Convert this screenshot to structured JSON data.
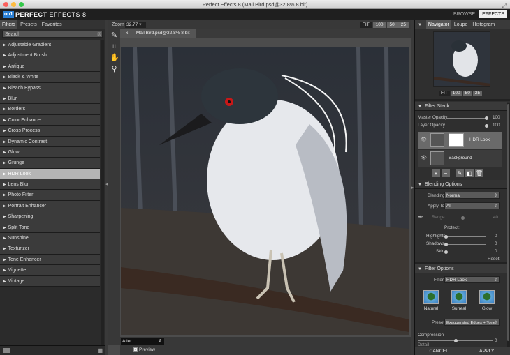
{
  "window": {
    "title": "Perfect Effects 8 (Mail Bird.psd@32.8% 8 bit)"
  },
  "brand": {
    "logo": "on1",
    "name_bold": "PERFECT",
    "name_rest": " EFFECTS 8"
  },
  "modes": {
    "browse": "BROWSE",
    "effects": "EFFECTS"
  },
  "left_panel": {
    "tabs": [
      "Filters",
      "Presets",
      "Favorites"
    ],
    "search_placeholder": "Search",
    "filters": [
      "Adjustable Gradient",
      "Adjustment Brush",
      "Antique",
      "Black & White",
      "Bleach Bypass",
      "Blur",
      "Borders",
      "Color Enhancer",
      "Cross Process",
      "Dynamic Contrast",
      "Glow",
      "Grunge",
      "HDR Look",
      "Lens Blur",
      "Photo Filter",
      "Portrait Enhancer",
      "Sharpening",
      "Split Tone",
      "Sunshine",
      "Texturizer",
      "Tone Enhancer",
      "Vignette",
      "Vintage"
    ],
    "selected_filter": "HDR Look"
  },
  "canvas": {
    "zoom_label": "Zoom",
    "zoom_value": "32.77",
    "zoom_buttons": [
      "FIT",
      "100",
      "50",
      "25"
    ],
    "doc_tab": "Mail Bird.psd@32.8% 8 bit",
    "view_mode": "After",
    "preview_label": "Preview"
  },
  "navigator": {
    "tabs": [
      "Navigator",
      "Loupe",
      "Histogram"
    ],
    "buttons": [
      "FIT",
      "100",
      "50",
      "25"
    ]
  },
  "filter_stack": {
    "title": "Filter Stack",
    "master_opacity": {
      "label": "Master Opacity",
      "value": "100",
      "level": 1.0
    },
    "layer_opacity": {
      "label": "Layer Opacity",
      "value": "100",
      "level": 1.0
    },
    "layers": [
      "HDR Look",
      "Background"
    ]
  },
  "blending": {
    "title": "Blending Options",
    "blending_label": "Blending",
    "blending_value": "Normal",
    "apply_to_label": "Apply To",
    "apply_to_value": "All",
    "range_label": "Range",
    "range_value": "40",
    "protect_label": "Protect:",
    "highlights": {
      "label": "Highlights",
      "value": "0"
    },
    "shadows": {
      "label": "Shadows",
      "value": "0"
    },
    "skin": {
      "label": "Skin",
      "value": "0"
    },
    "reset": "Reset"
  },
  "filter_options": {
    "title": "Filter Options",
    "filter_label": "Filter",
    "filter_value": "HDR Look",
    "presets": [
      "Natural",
      "Surreal",
      "Glow"
    ],
    "preset_label": "Preset",
    "preset_value": "Exaggerated Edges + Tone",
    "compression_label": "Compression",
    "compression_value": "0",
    "detail_label": "Detail"
  },
  "footer": {
    "cancel": "CANCEL",
    "apply": "APPLY"
  },
  "colors": {
    "accent": "#2a7fd4",
    "selected_row": "#b5b5b5"
  }
}
